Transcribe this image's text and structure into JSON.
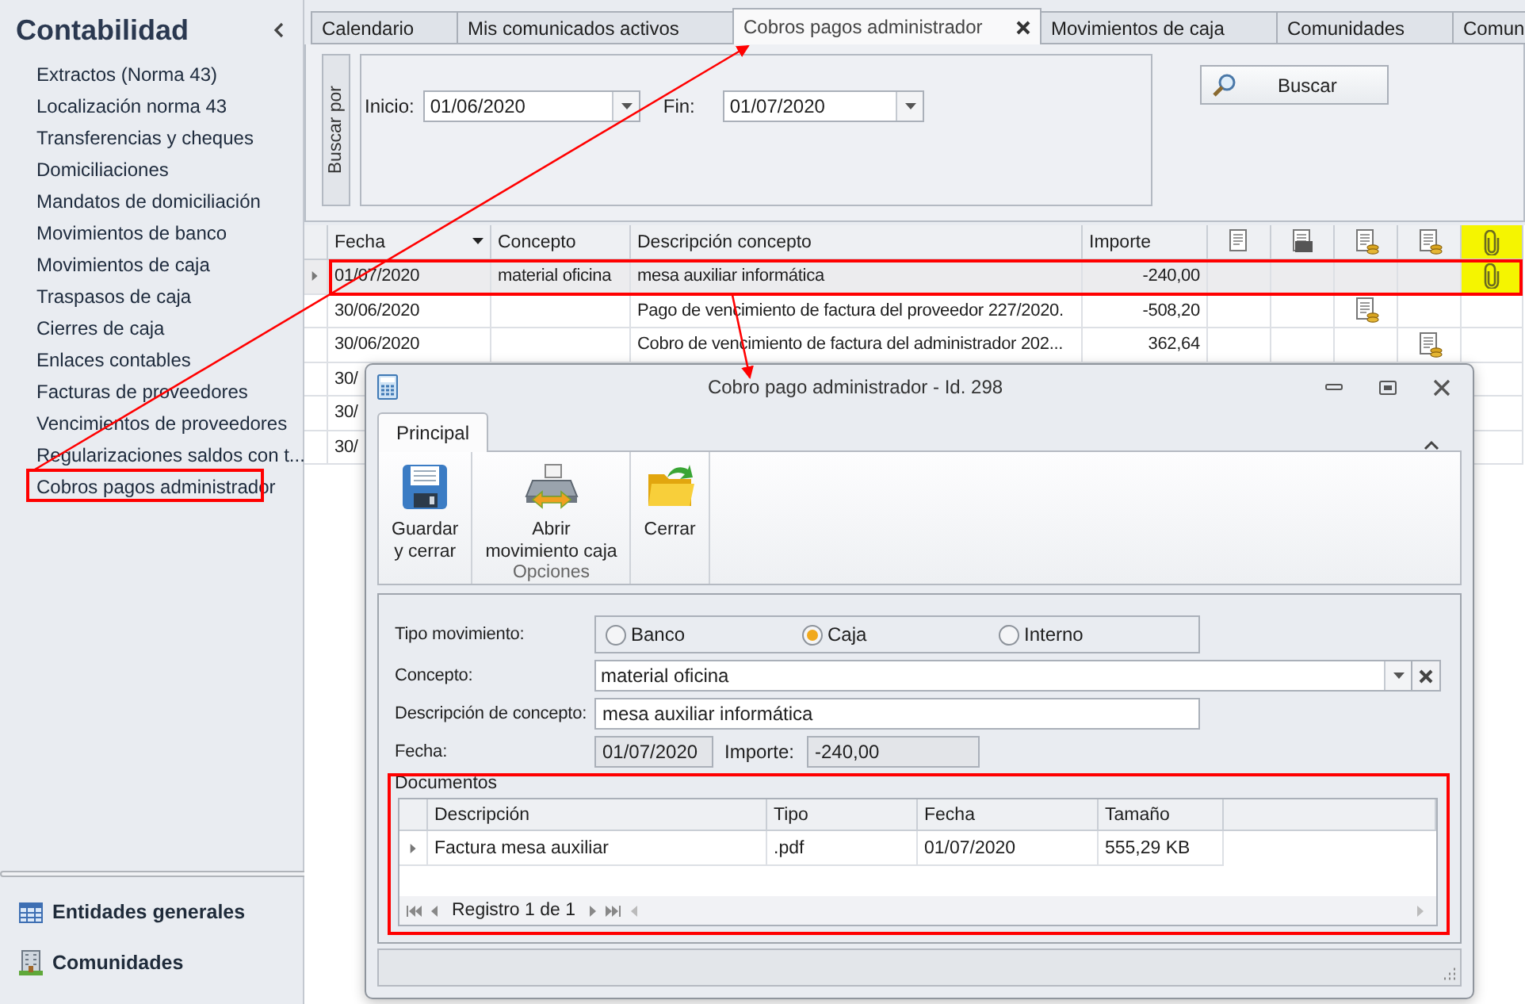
{
  "sidebar": {
    "title": "Contabilidad",
    "items": [
      "Extractos (Norma 43)",
      "Localización norma 43",
      "Transferencias y cheques",
      "Domiciliaciones",
      "Mandatos de domiciliación",
      "Movimientos de banco",
      "Movimientos de caja",
      "Traspasos de caja",
      "Cierres de caja",
      "Enlaces contables",
      "Facturas de proveedores",
      "Vencimientos de proveedores",
      "Regularizaciones saldos con t...",
      "Cobros pagos administrador"
    ],
    "bottom_nav": [
      {
        "label": "Entidades generales",
        "kind": "entities"
      },
      {
        "label": "Comunidades",
        "kind": "communities"
      }
    ]
  },
  "tabs": [
    {
      "label": "Calendario",
      "selected": false
    },
    {
      "label": "Mis comunicados activos",
      "selected": false
    },
    {
      "label": "Cobros pagos administrador",
      "selected": true
    },
    {
      "label": "Movimientos de caja",
      "selected": false
    },
    {
      "label": "Comunidades",
      "selected": false
    },
    {
      "label": "Comun",
      "selected": false
    }
  ],
  "search": {
    "group_label": "Buscar por",
    "start": {
      "label": "Inicio:",
      "value": "01/06/2020"
    },
    "end": {
      "label": "Fin:",
      "value": "01/07/2020"
    },
    "button": "Buscar"
  },
  "grid": {
    "columns": [
      {
        "label": "Fecha",
        "sorted": true
      },
      {
        "label": "Concepto",
        "sorted": false
      },
      {
        "label": "Descripción concepto",
        "sorted": false
      },
      {
        "label": "Importe",
        "sorted": false
      }
    ],
    "icon_columns": [
      {
        "kind": "document",
        "highlighted": false
      },
      {
        "kind": "scanner",
        "highlighted": false
      },
      {
        "kind": "invoice-payment",
        "highlighted": false
      },
      {
        "kind": "invoice-receipt",
        "highlighted": false
      },
      {
        "kind": "attachment",
        "highlighted": true
      }
    ],
    "rows": [
      {
        "fecha": "01/07/2020",
        "concepto": "material oficina",
        "descripcion": "mesa auxiliar informática",
        "importe": "-240,00",
        "selected": true,
        "marks": [
          false,
          false,
          false,
          false,
          true
        ]
      },
      {
        "fecha": "30/06/2020",
        "descripcion": "Pago de vencimiento de factura del proveedor 227/2020.",
        "importe": "-508,20",
        "selected": false,
        "marks": [
          false,
          false,
          true,
          false,
          false
        ]
      },
      {
        "fecha": "30/06/2020",
        "descripcion": "Cobro de vencimiento de factura del administrador  202...",
        "importe": "362,64",
        "selected": false,
        "marks": [
          false,
          false,
          false,
          true,
          false
        ]
      },
      {
        "fecha": "30/",
        "selected": false
      },
      {
        "fecha": "30/",
        "selected": false
      },
      {
        "fecha": "30/",
        "selected": false
      }
    ]
  },
  "dialog": {
    "title": "Cobro pago administrador - Id. 298",
    "ribbon_tabs": [
      {
        "label": "Principal",
        "selected": true
      }
    ],
    "ribbon_groups": [
      {
        "buttons": [
          {
            "kind": "save",
            "lines": [
              "Guardar",
              "y cerrar"
            ]
          }
        ]
      },
      {
        "label": "Opciones",
        "buttons": [
          {
            "kind": "cash-register",
            "lines": [
              "Abrir",
              "movimiento caja"
            ]
          }
        ]
      },
      {
        "buttons": [
          {
            "kind": "folder",
            "lines": [
              "Cerrar"
            ]
          }
        ]
      }
    ],
    "form": {
      "movement_type": {
        "label": "Tipo movimiento:",
        "options": [
          {
            "label": "Banco",
            "selected": false
          },
          {
            "label": "Caja",
            "selected": true
          },
          {
            "label": "Interno",
            "selected": false
          }
        ]
      },
      "concept": {
        "label": "Concepto:",
        "value": "material oficina"
      },
      "concept_description": {
        "label": "Descripción de concepto:",
        "value": "mesa auxiliar informática"
      },
      "date": {
        "label": "Fecha:",
        "value": "01/07/2020"
      },
      "amount": {
        "label": "Importe:",
        "value": "-240,00"
      }
    },
    "documents": {
      "title": "Documentos",
      "columns": [
        "Descripción",
        "Tipo",
        "Fecha",
        "Tamaño"
      ],
      "rows": [
        {
          "cells": [
            "Factura mesa auxiliar",
            ".pdf",
            "01/07/2020",
            "555,29 KB"
          ],
          "selected": true
        }
      ],
      "pager": "Registro 1 de 1"
    }
  }
}
